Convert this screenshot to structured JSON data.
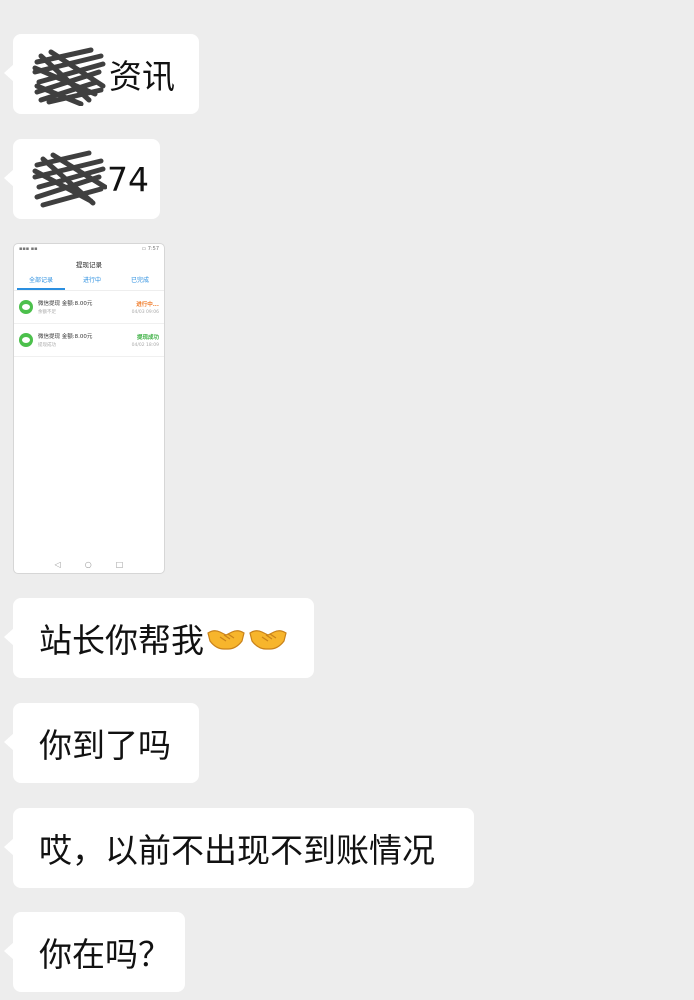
{
  "messages": [
    {
      "text": "资讯",
      "redacted": true
    },
    {
      "text": "74",
      "redacted": true
    },
    {
      "type": "image",
      "screenshot": {
        "title": "提现记录",
        "tabs": [
          "全部记录",
          "进行中",
          "已完成"
        ],
        "records": [
          {
            "title": "微信提现 金额:8.00元",
            "subtitle": "余额不足",
            "status": "进行中...",
            "date": "04/03 09:06",
            "status_color": "#f07c2a"
          },
          {
            "title": "微信提现 金额:8.00元",
            "subtitle": "提现成功",
            "status": "提现成功",
            "date": "04/02 18:09",
            "status_color": "#3cb043"
          }
        ],
        "nav": [
          "◁",
          "○",
          "□"
        ]
      }
    },
    {
      "text": "站长你帮我",
      "emoji": [
        "handshake-emoji",
        "handshake-emoji"
      ]
    },
    {
      "text": "你到了吗"
    },
    {
      "text": "哎，以前不出现不到账情况"
    },
    {
      "text": "你在吗？"
    }
  ],
  "colors": {
    "background": "#ededed",
    "bubble": "#ffffff",
    "text": "#111111"
  }
}
